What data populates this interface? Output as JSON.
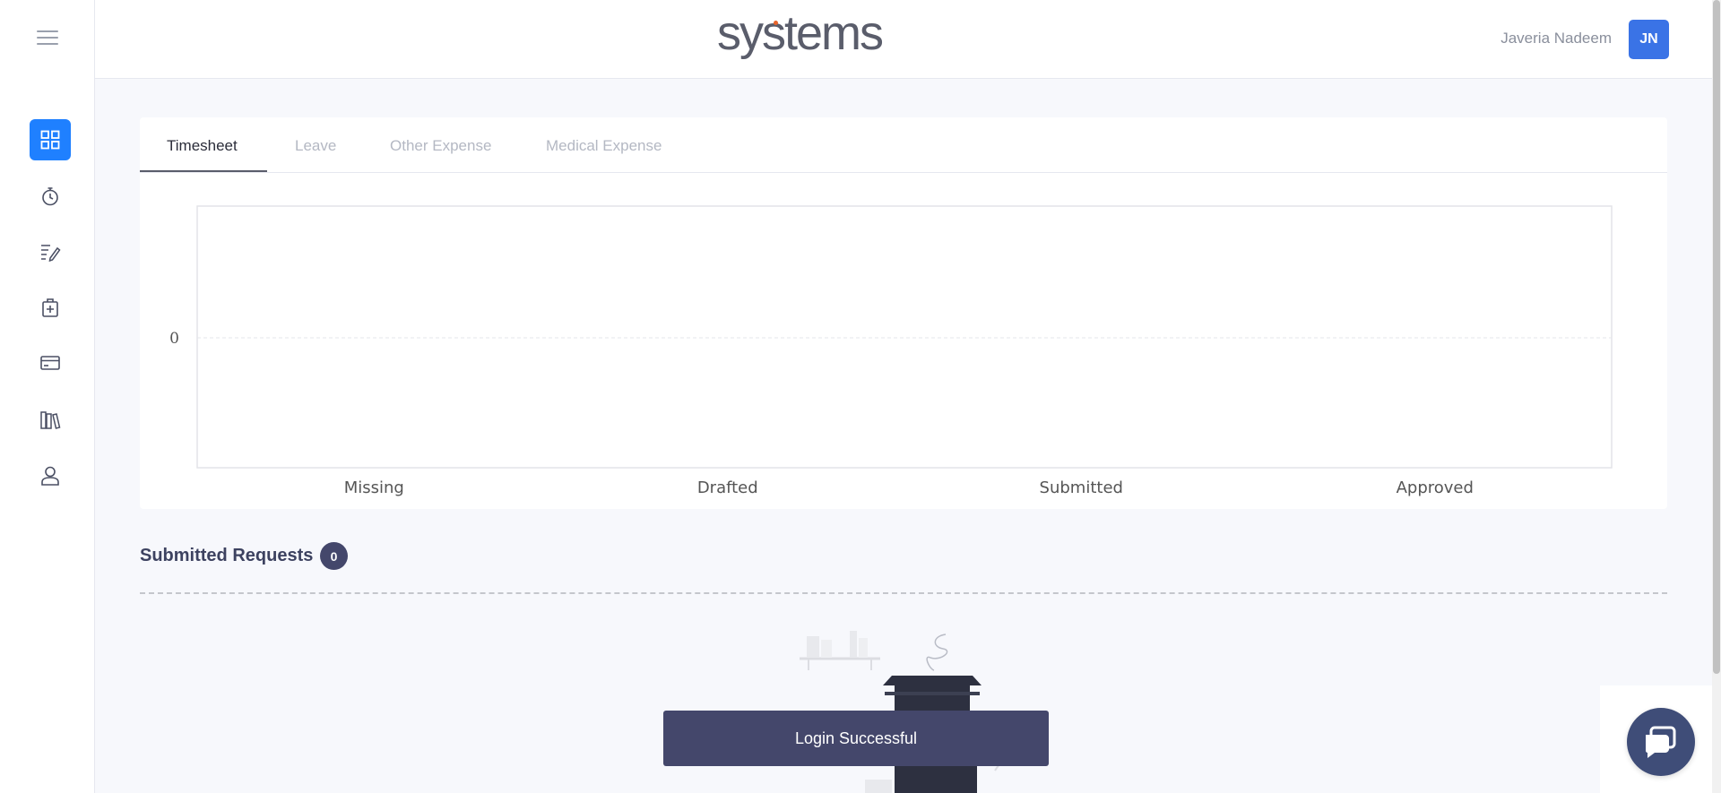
{
  "app": {
    "logo_text": "systems"
  },
  "header": {
    "user_name": "Javeria Nadeem",
    "user_initials": "JN"
  },
  "sidebar": {
    "items": [
      {
        "icon": "dashboard-grid-icon",
        "active": true
      },
      {
        "icon": "stopwatch-icon",
        "active": false
      },
      {
        "icon": "timesheet-edit-icon",
        "active": false
      },
      {
        "icon": "briefcase-medical-icon",
        "active": false
      },
      {
        "icon": "credit-card-icon",
        "active": false
      },
      {
        "icon": "books-icon",
        "active": false
      },
      {
        "icon": "user-icon",
        "active": false
      }
    ]
  },
  "tabs": [
    {
      "label": "Timesheet",
      "active": true
    },
    {
      "label": "Leave",
      "active": false
    },
    {
      "label": "Other Expense",
      "active": false
    },
    {
      "label": "Medical Expense",
      "active": false
    }
  ],
  "chart_data": {
    "type": "bar",
    "categories": [
      "Missing",
      "Drafted",
      "Submitted",
      "Approved"
    ],
    "values": [
      0,
      0,
      0,
      0
    ],
    "y_ticks": [
      "0"
    ],
    "title": "",
    "xlabel": "",
    "ylabel": "",
    "grid": true
  },
  "submitted_requests": {
    "title": "Submitted Requests",
    "count": "0"
  },
  "toast": {
    "message": "Login Successful"
  },
  "colors": {
    "accent": "#1f80ff",
    "avatar": "#3a73e6",
    "badge": "#44476b",
    "toast": "#44476b"
  }
}
